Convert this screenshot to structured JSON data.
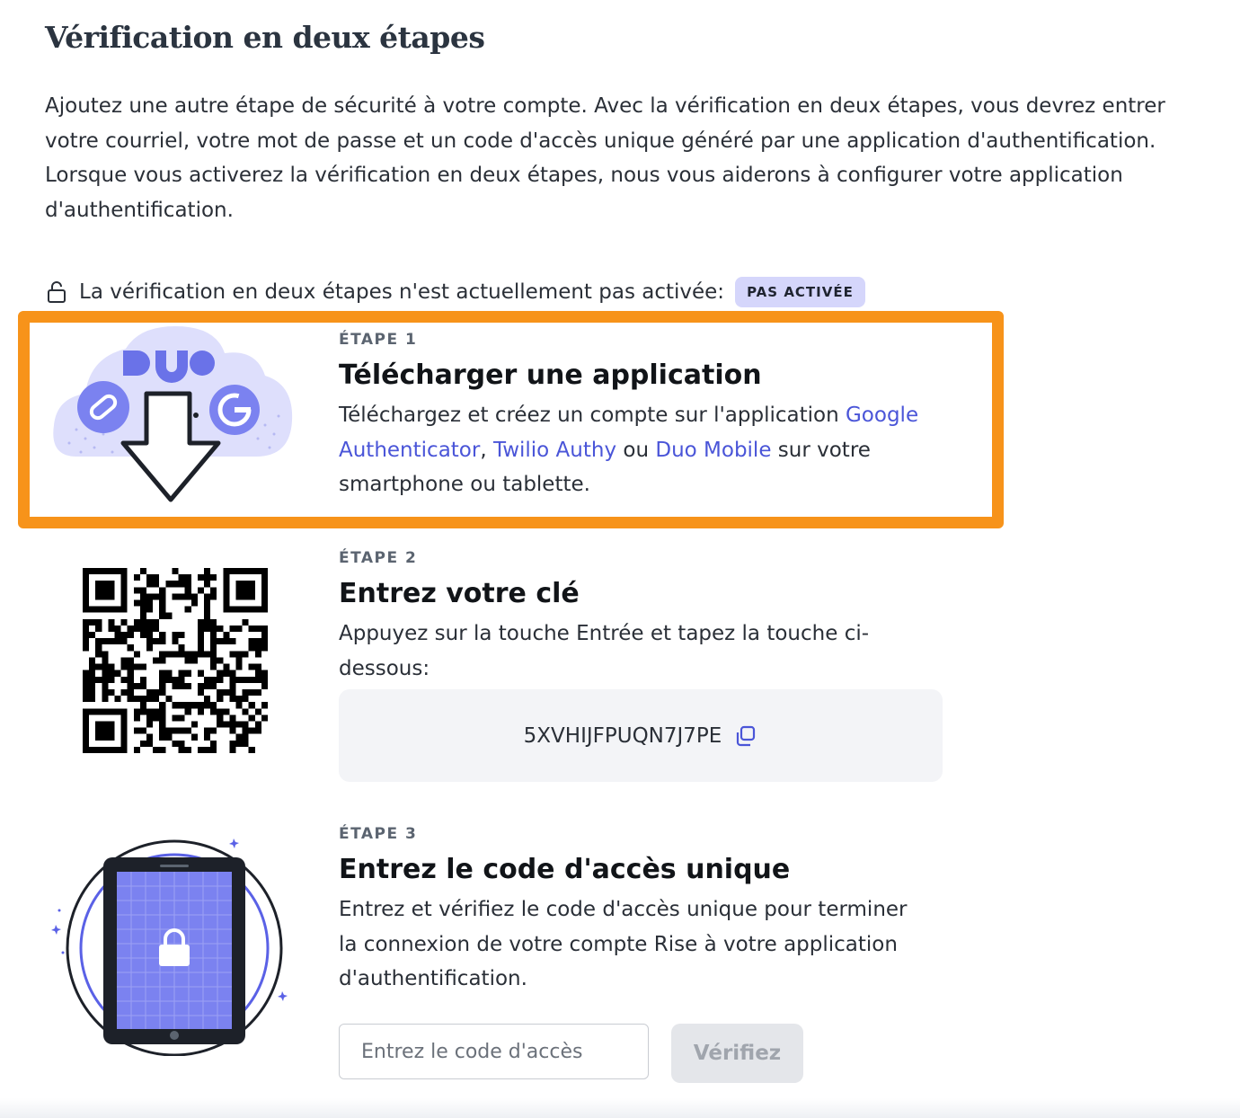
{
  "page": {
    "title": "Vérification en deux étapes",
    "intro": "Ajoutez une autre étape de sécurité à votre compte. Avec la vérification en deux étapes, vous devrez entrer votre courriel, votre mot de passe et un code d'accès unique généré par une application d'authentification. Lorsque vous activerez la vérification en deux étapes, nous vous aiderons à configurer votre application d'authentification."
  },
  "status": {
    "text": "La vérification en deux étapes n'est actuellement pas activée:",
    "badge": "PAS ACTIVÉE",
    "icon": "unlocked-padlock-icon"
  },
  "step1": {
    "label": "ÉTAPE 1",
    "title": "Télécharger une application",
    "desc_before": "Téléchargez et créez un compte sur l'application ",
    "link_google": "Google Authenticator",
    "sep": ", ",
    "link_authy": "Twilio Authy",
    "or": " ou ",
    "link_duo": "Duo Mobile",
    "desc_after": " sur votre smartphone ou tablette.",
    "illustration_logo": "DUO"
  },
  "step2": {
    "label": "ÉTAPE 2",
    "title": "Entrez votre clé",
    "desc": "Appuyez sur la touche Entrée et tapez la touche ci-dessous:",
    "key": "5XVHIJFPUQN7J7PE",
    "icon": "copy-icon"
  },
  "step3": {
    "label": "ÉTAPE 3",
    "title": "Entrez le code d'accès unique",
    "desc": "Entrez et vérifiez le code d'accès unique pour terminer la connexion de votre compte Rise à votre application d'authentification.",
    "input_placeholder": "Entrez le code d'accès",
    "button_label": "Vérifiez"
  },
  "colors": {
    "accent": "#4a55d8",
    "highlight": "#f7931a",
    "badge_bg": "#d5d6fb",
    "illustration": "#7b82f0"
  }
}
